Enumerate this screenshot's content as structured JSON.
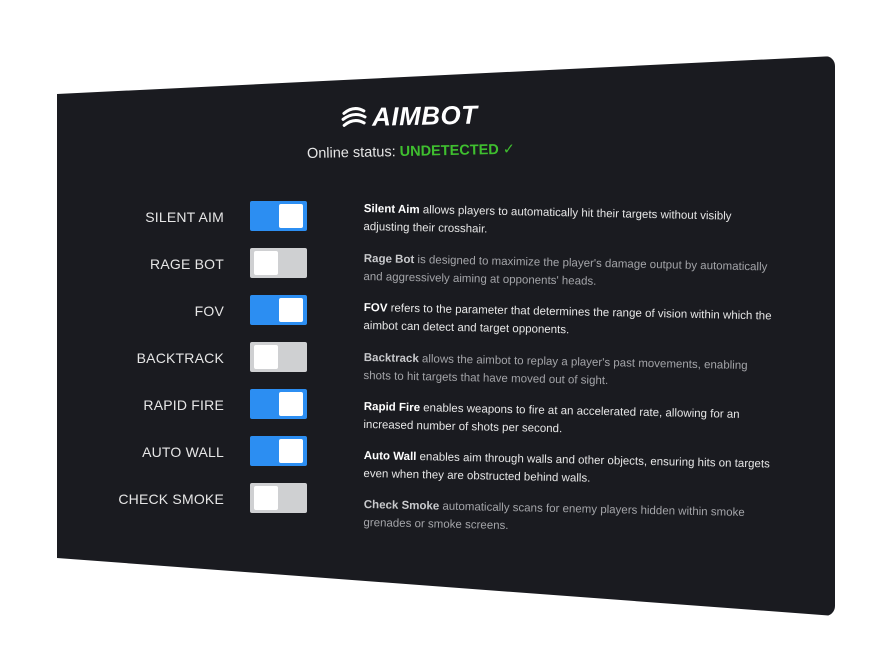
{
  "brand": {
    "name": "AIMBOT",
    "logo_icon": "swirl-logo-icon"
  },
  "status": {
    "prefix": "Online status:",
    "value": "UNDETECTED",
    "check": "✓",
    "color": "#3fbf2f"
  },
  "accent": "#2c8ef2",
  "features": [
    {
      "label": "SILENT AIM",
      "enabled": true,
      "desc_name": "Silent Aim",
      "desc_text": " allows players to automatically hit their targets without visibly adjusting their crosshair."
    },
    {
      "label": "RAGE BOT",
      "enabled": false,
      "desc_name": "Rage Bot",
      "desc_text": " is designed to maximize the player's damage output by automatically and aggressively aiming at opponents' heads."
    },
    {
      "label": "FOV",
      "enabled": true,
      "desc_name": "FOV",
      "desc_text": " refers to the parameter that determines the range of vision within which the aimbot can detect and target opponents."
    },
    {
      "label": "BACKTRACK",
      "enabled": false,
      "desc_name": "Backtrack",
      "desc_text": " allows the aimbot to replay a player's past movements, enabling shots to hit targets that have moved out of sight."
    },
    {
      "label": "RAPID FIRE",
      "enabled": true,
      "desc_name": "Rapid Fire",
      "desc_text": " enables weapons to fire at an accelerated rate, allowing for an increased number of shots per second."
    },
    {
      "label": "AUTO WALL",
      "enabled": true,
      "desc_name": "Auto Wall",
      "desc_text": " enables aim through walls and other objects, ensuring hits on targets even when they are obstructed behind walls."
    },
    {
      "label": "CHECK SMOKE",
      "enabled": false,
      "desc_name": "Check Smoke",
      "desc_text": " automatically scans for enemy players hidden within smoke grenades or smoke screens."
    }
  ]
}
